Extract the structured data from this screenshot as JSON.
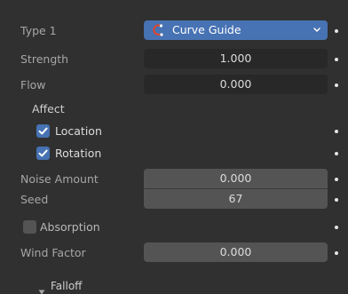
{
  "type": {
    "label": "Type 1",
    "value": "Curve Guide"
  },
  "strength": {
    "label": "Strength",
    "value": "1.000"
  },
  "flow": {
    "label": "Flow",
    "value": "0.000"
  },
  "affect": {
    "heading": "Affect",
    "location": {
      "label": "Location",
      "checked": true
    },
    "rotation": {
      "label": "Rotation",
      "checked": true
    }
  },
  "noise_amount": {
    "label": "Noise Amount",
    "value": "0.000"
  },
  "seed": {
    "label": "Seed",
    "value": "67"
  },
  "absorption": {
    "label": "Absorption",
    "checked": false
  },
  "wind_factor": {
    "label": "Wind Factor",
    "value": "0.000"
  },
  "falloff": {
    "label": "Falloff",
    "collapsed": true
  },
  "colors": {
    "background": "#303030",
    "field": "#545454",
    "field_dark": "#282828",
    "accent": "#4772b3",
    "curve_icon": "#e0452b"
  }
}
